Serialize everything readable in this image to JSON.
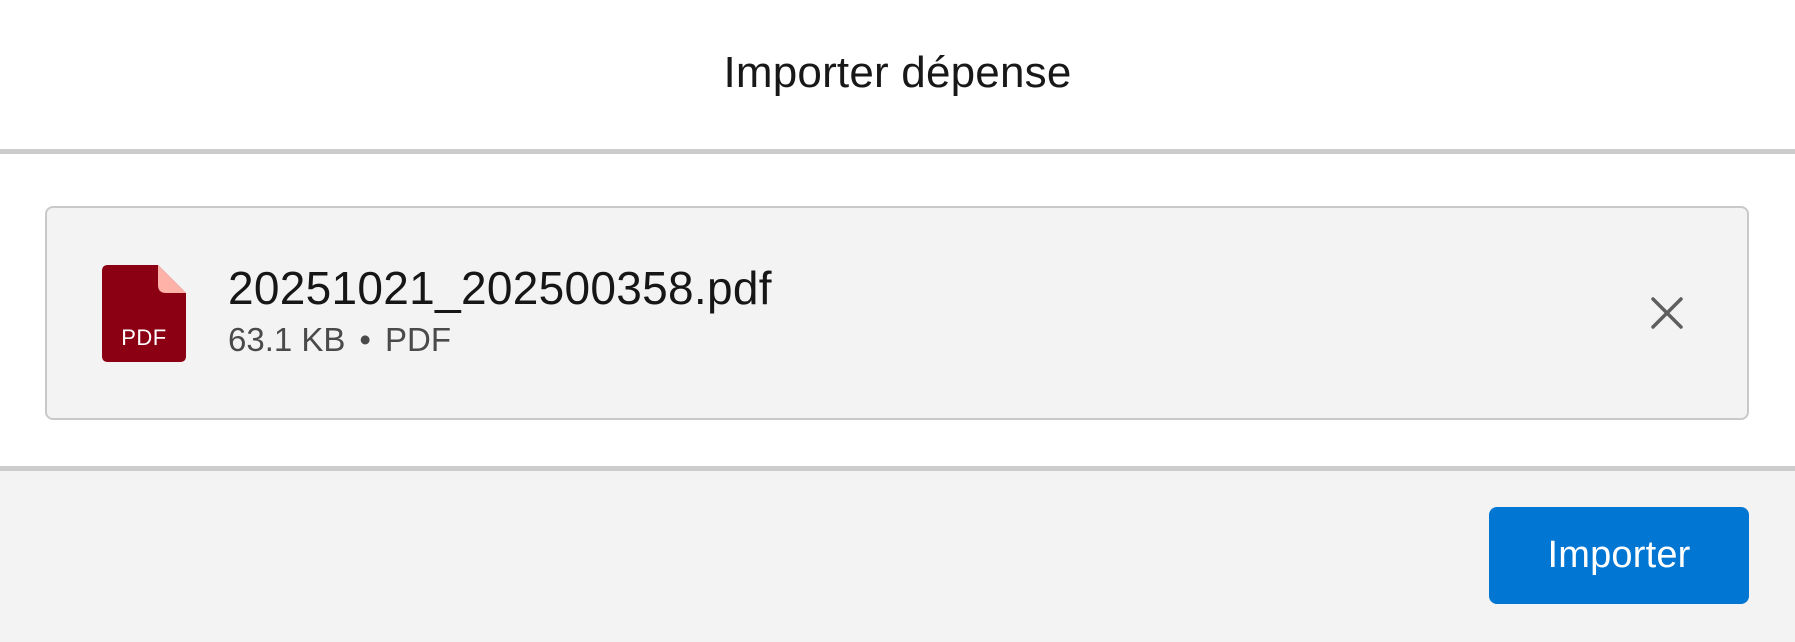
{
  "modal": {
    "title": "Importer dépense"
  },
  "file": {
    "icon": "pdf-file-icon",
    "icon_label": "PDF",
    "name": "20251021_202500358.pdf",
    "size": "63.1 KB",
    "separator": "•",
    "type": "PDF",
    "remove_icon": "close-icon"
  },
  "footer": {
    "import_label": "Importer"
  },
  "colors": {
    "pdf_icon": "#8c0014",
    "pdf_fold": "#ffb3a8",
    "primary_button": "#0176d3",
    "card_background": "#f3f3f3",
    "divider": "#cccccc"
  }
}
